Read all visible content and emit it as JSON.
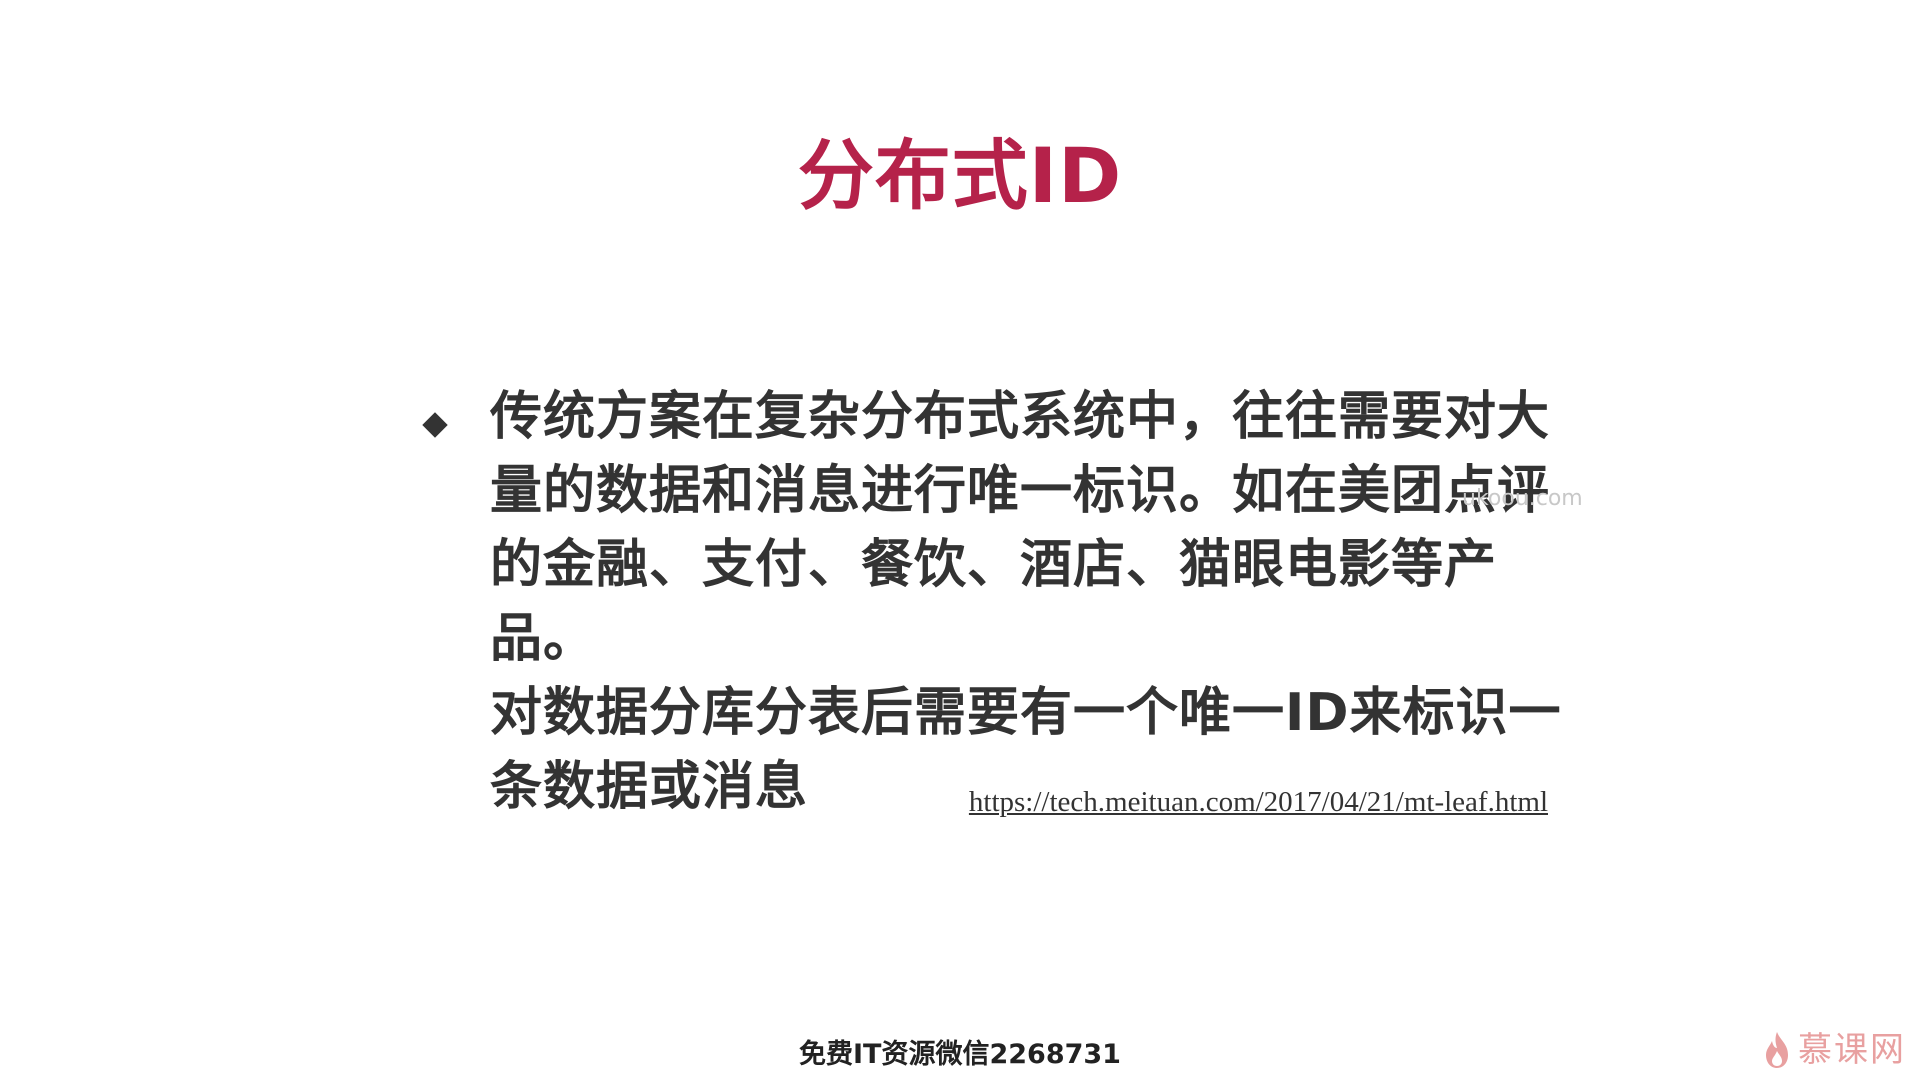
{
  "slide": {
    "title": "分布式ID",
    "bullet": {
      "icon": "diamond-bullet-icon",
      "lines": [
        "传统方案在复杂分布式系统中，往往需要对大",
        "量的数据和消息进行唯一标识。如在美团点评",
        "的金融、支付、餐饮、酒店、猫眼电影等产品。",
        "对数据分库分表后需要有一个唯一ID来标识一",
        "条数据或消息"
      ]
    },
    "source_link": "https://tech.meituan.com/2017/04/21/mt-leaf.html"
  },
  "watermarks": {
    "site": "ukoou.com",
    "bottom": "免费IT资源微信2268731"
  },
  "brand": {
    "name": "慕课网",
    "icon": "flame-logo-icon"
  },
  "colors": {
    "title": "#b5224a",
    "body_text": "#333333",
    "brand": "#e8a0a0"
  }
}
